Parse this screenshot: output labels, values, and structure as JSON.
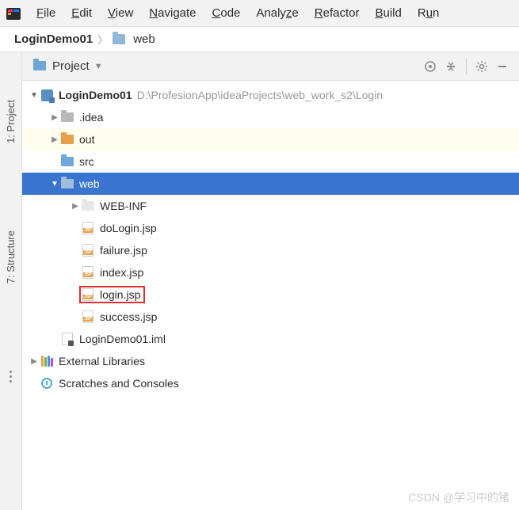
{
  "menu": [
    "File",
    "Edit",
    "View",
    "Navigate",
    "Code",
    "Analyze",
    "Refactor",
    "Build",
    "Run"
  ],
  "breadcrumb": {
    "root": "LoginDemo01",
    "child": "web"
  },
  "dock": {
    "project": "1: Project",
    "structure": "7: Structure"
  },
  "panel": {
    "title": "Project"
  },
  "tree": {
    "root": {
      "name": "LoginDemo01",
      "path": "D:\\ProfesionApp\\ideaProjects\\web_work_s2\\Login"
    },
    "idea": ".idea",
    "out": "out",
    "src": "src",
    "web": "web",
    "webinf": "WEB-INF",
    "files": [
      "doLogin.jsp",
      "failure.jsp",
      "index.jsp",
      "login.jsp",
      "success.jsp"
    ],
    "iml": "LoginDemo01.iml",
    "extlib": "External Libraries",
    "scratches": "Scratches and Consoles"
  },
  "watermark": "CSDN @学习中的猪"
}
